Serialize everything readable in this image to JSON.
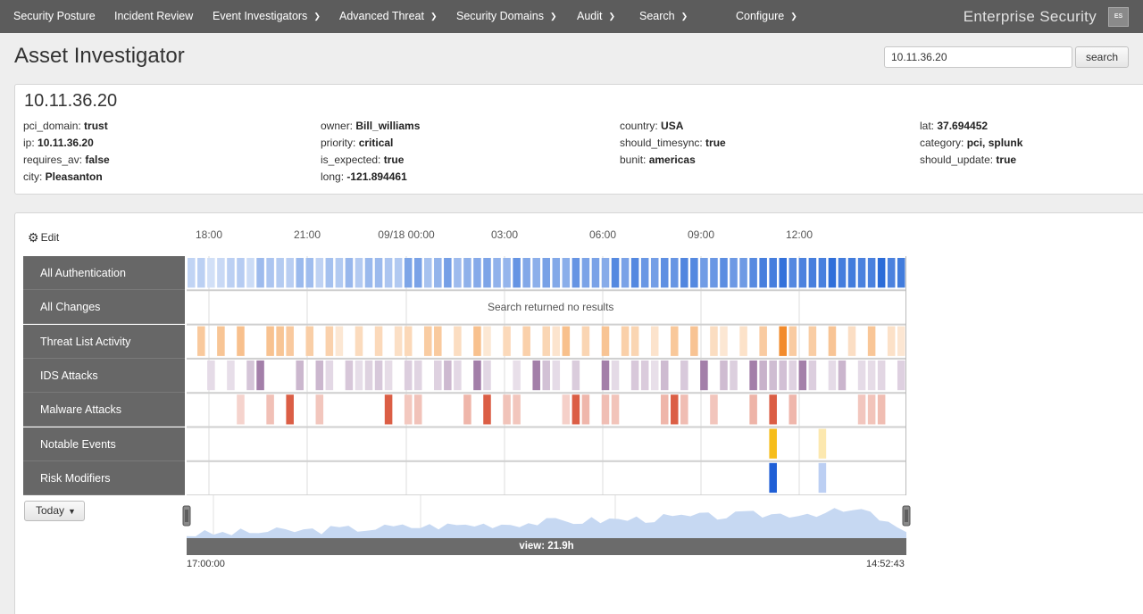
{
  "nav": {
    "items": [
      {
        "label": "Security Posture",
        "caret": false
      },
      {
        "label": "Incident Review",
        "caret": false
      },
      {
        "label": "Event Investigators",
        "caret": true
      },
      {
        "label": "Advanced Threat",
        "caret": true
      },
      {
        "label": "Security Domains",
        "caret": true
      },
      {
        "label": "Audit",
        "caret": true
      },
      {
        "label": "Search",
        "caret": true
      },
      {
        "label": "Configure",
        "caret": true
      }
    ],
    "brand": "Enterprise Security",
    "badge": "ES"
  },
  "page": {
    "title": "Asset Investigator",
    "search_value": "10.11.36.20",
    "search_button": "search"
  },
  "asset": {
    "title": "10.11.36.20",
    "fields": [
      {
        "key": "pci_domain:",
        "value": "trust"
      },
      {
        "key": "ip:",
        "value": "10.11.36.20"
      },
      {
        "key": "requires_av:",
        "value": "false"
      },
      {
        "key": "city:",
        "value": "Pleasanton"
      },
      {
        "key": "owner:",
        "value": "Bill_williams"
      },
      {
        "key": "priority:",
        "value": "critical"
      },
      {
        "key": "is_expected:",
        "value": "true"
      },
      {
        "key": "long:",
        "value": "-121.894461"
      },
      {
        "key": "country:",
        "value": "USA"
      },
      {
        "key": "should_timesync:",
        "value": "true"
      },
      {
        "key": "bunit:",
        "value": "americas"
      },
      {
        "key": "lat:",
        "value": "37.694452"
      },
      {
        "key": "category:",
        "value": "pci, splunk"
      },
      {
        "key": "should_update:",
        "value": "true"
      }
    ]
  },
  "timeline": {
    "edit_label": "Edit",
    "ticks": [
      "18:00",
      "21:00",
      "09/18 00:00",
      "03:00",
      "06:00",
      "09:00",
      "12:00"
    ],
    "no_results": "Search returned no results",
    "today_label": "Today",
    "view_label": "view: 21.9h",
    "start_time": "17:00:00",
    "end_time": "14:52:43",
    "lanes": [
      {
        "label": "All Authentication",
        "color": "#1f63d6"
      },
      {
        "label": "All Changes",
        "color": "#cccccc"
      },
      {
        "label": "Threat List Activity",
        "color": "#f28b2c"
      },
      {
        "label": "IDS Attacks",
        "color": "#8c5f93"
      },
      {
        "label": "Malware Attacks",
        "color": "#d9553b"
      },
      {
        "label": "Notable Events",
        "color": "#f6bd1a"
      },
      {
        "label": "Risk Modifiers",
        "color": "#1f5fd6"
      }
    ]
  }
}
